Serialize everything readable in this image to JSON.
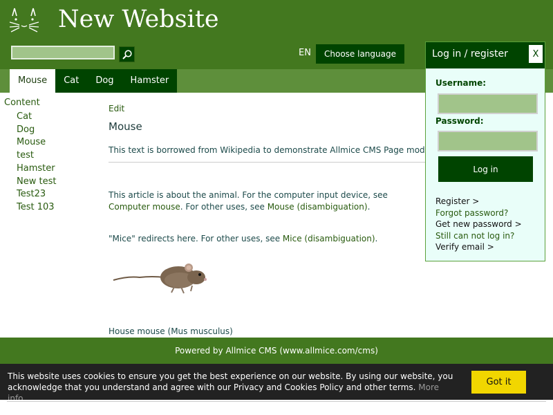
{
  "header": {
    "site_title": "New Website",
    "search_placeholder": "",
    "lang_code": "EN",
    "choose_language_label": "Choose language"
  },
  "nav": {
    "tabs": [
      {
        "label": "Mouse",
        "active": true
      },
      {
        "label": "Cat",
        "active": false
      },
      {
        "label": "Dog",
        "active": false
      },
      {
        "label": "Hamster",
        "active": false
      }
    ]
  },
  "sidebar": {
    "title": "Content",
    "items": [
      "Cat",
      "Dog",
      "Mouse",
      "test",
      "Hamster",
      "New test",
      "Test23",
      "Test 103"
    ]
  },
  "main": {
    "edit_label": "Edit",
    "heading": "Mouse",
    "intro": "This text is borrowed from Wikipedia to demonstrate Allmice CMS Page module.",
    "about_text_1": "This article is about the animal. For the computer input device, see ",
    "about_link_1": "Computer mouse",
    "about_text_2": ". For other uses, see ",
    "about_link_2": "Mouse (disambiguation)",
    "about_text_3": ".",
    "redirect_text_1": "\"Mice\" redirects here. For other uses, see ",
    "redirect_link": "Mice (disambiguation)",
    "redirect_text_2": ".",
    "caption": "House mouse (Mus musculus)"
  },
  "footer": {
    "text": "Powered by Allmice CMS (www.allmice.com/cms)"
  },
  "cookie": {
    "text": "This website uses cookies to ensure you get the best experience on our website. By using our website, you acknowledge that you understand and agree with our Privacy and Cookies Policy and other terms.",
    "more_info_label": "More info",
    "accept_label": "Got it"
  },
  "login": {
    "title": "Log in / register",
    "close_label": "X",
    "username_label": "Username:",
    "password_label": "Password:",
    "submit_label": "Log in",
    "links": {
      "register": "Register >",
      "forgot": "Forgot password?",
      "new_password": "Get new password >",
      "cannot_login": "Still can not log in?",
      "verify_email": "Verify email >"
    }
  },
  "colors": {
    "header_bg": "#43781f",
    "nav_bg": "#5e8f3b",
    "dark_green": "#004400",
    "accent_yellow": "#f1d600",
    "panel_bg": "#e9fef9"
  },
  "icons": {
    "logo": "cat-face-icon",
    "search": "magnifier-icon"
  }
}
